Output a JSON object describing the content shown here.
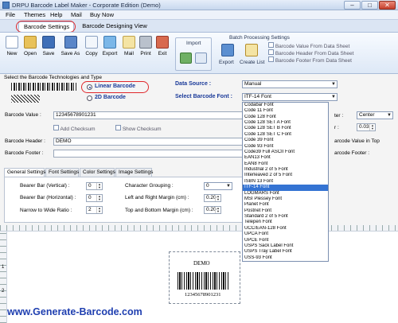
{
  "window": {
    "title": "DRPU Barcode Label Maker - Corporate Edition (Demo)",
    "min": "–",
    "max": "□",
    "close": "✕"
  },
  "menu": [
    "File",
    "Themes",
    "Help",
    "Mail",
    "Buy Now"
  ],
  "ribbon_tabs": [
    "Barcode Settings",
    "Barcode Designing View"
  ],
  "toolbar": [
    "New",
    "Open",
    "Save",
    "Save As",
    "Copy",
    "Export",
    "Mail",
    "Print",
    "Exit"
  ],
  "import_group": {
    "title": "Import"
  },
  "batch": {
    "title": "Batch Processing Settings",
    "export": "Export",
    "create_list": "Create List",
    "options": [
      "Barcode Value From Data Sheet",
      "Barcode Header From Data Sheet",
      "Barcode Footer From Data Sheet"
    ]
  },
  "techsection": {
    "label": "Select the Barcode Technologies and Type",
    "linear": "Linear Barcode",
    "twod": "2D Barcode"
  },
  "datasource": {
    "label": "Data Source :",
    "value": "Manual"
  },
  "barcodefont": {
    "label": "Select Barcode Font :",
    "value": "ITF-14 Font"
  },
  "fonts": [
    "Codabar Font",
    "Code 11 Font",
    "Code 128 Font",
    "Code 128 SET A Font",
    "Code 128 SET B Font",
    "Code 128 SET C Font",
    "Code 39 Font",
    "Code 93 Font",
    "Code39 Full ASCII Font",
    "EAN13 Font",
    "EAN8 Font",
    "Industrial 2 of 5 Font",
    "Interleaved 2 of 5 Font",
    "ISBN 13 Font",
    "ITF-14 Font",
    "LOGMARS Font",
    "MSI Plessey Font",
    "Planet Font",
    "Postnet Font",
    "Standard 2 of 5 Font",
    "Telepen Font",
    "UCC/EAN-128 Font",
    "UPCA Font",
    "UPCE Font",
    "USPS Sack Label Font",
    "USPS Tray Label Font",
    "USS-93 Font"
  ],
  "fonts_selected_index": 14,
  "barcode_value": {
    "label": "Barcode Value :",
    "value": "12345678901231"
  },
  "add_checksum": "Add Checksum",
  "show_checksum": "Show Checksum",
  "header": {
    "label": "Barcode Header :",
    "value": "DEMO"
  },
  "footer": {
    "label": "Barcode Footer :",
    "value": ""
  },
  "right_side": {
    "align_label": "ter :",
    "align_value": "Center",
    "num_label": "r :",
    "num_value": "0.03",
    "value_top": "arcode Value in Top",
    "footer_text": "arcode Footer :"
  },
  "settings_tabs": [
    "General Settings",
    "Font Settings",
    "Color Settings",
    "Image Settings"
  ],
  "general": {
    "bearer_v": {
      "label": "Bearer Bar (Vertical) :",
      "value": "0"
    },
    "bearer_h": {
      "label": "Bearer Bar (Horizontal) :",
      "value": "0"
    },
    "narrow": {
      "label": "Narrow to Wide Ratio :",
      "value": "2"
    },
    "char_group": {
      "label": "Character Grouping :",
      "value": "0"
    },
    "lr_margin": {
      "label": "Left and Right Margin (cm) :",
      "value": "0.20"
    },
    "tb_margin": {
      "label": "Top and Bottom Margin (cm) :",
      "value": "0.20"
    }
  },
  "preview": {
    "header": "DEMO",
    "digits": "12345678901231",
    "ruler_marks": [
      "1",
      "2"
    ]
  },
  "website": "www.Generate-Barcode.com",
  "colors": {
    "accent_red": "#e0282c",
    "link_blue": "#1f3fb0",
    "selection": "#3473d3"
  }
}
